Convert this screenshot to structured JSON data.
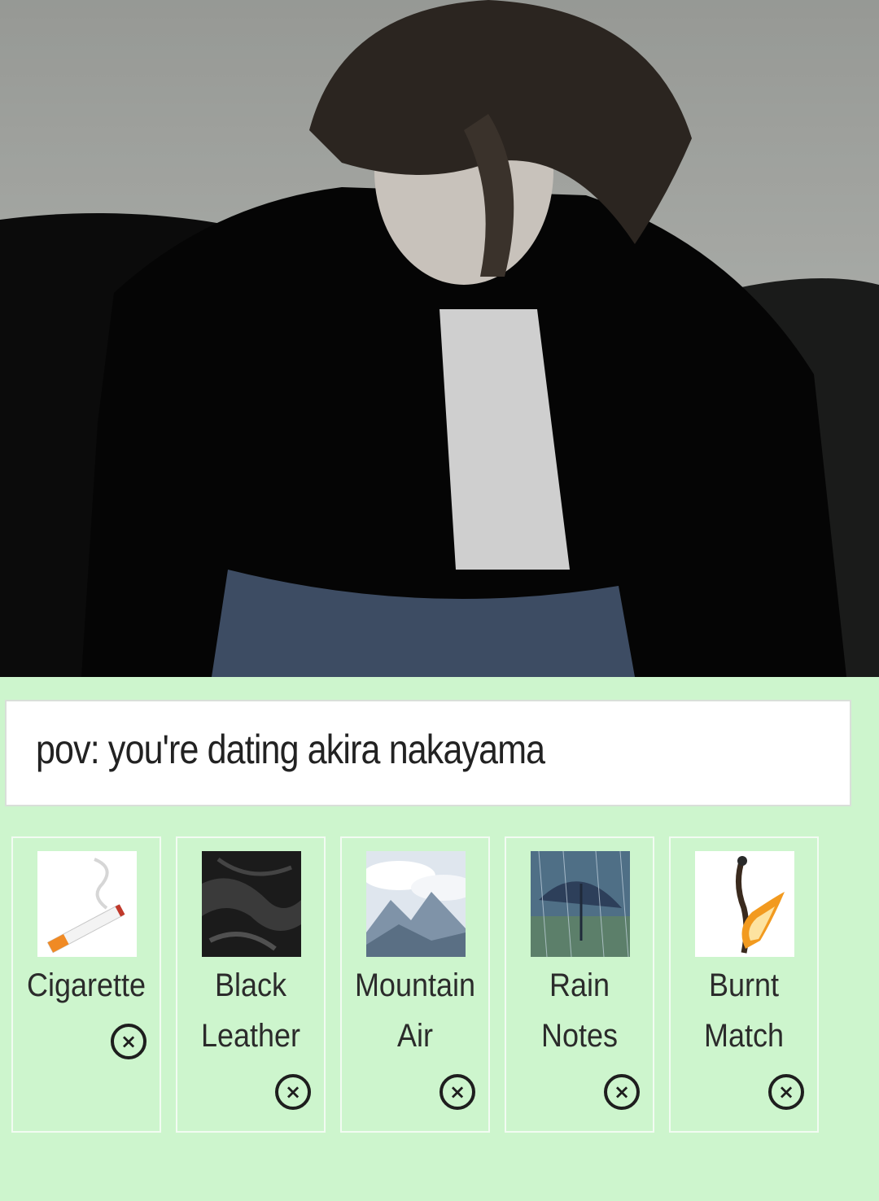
{
  "post": {
    "title": "pov: you're dating akira nakayama"
  },
  "tags": [
    {
      "label_line1": "Cigarette",
      "label_line2": "",
      "icon": "cigarette-icon"
    },
    {
      "label_line1": "Black",
      "label_line2": "Leather",
      "icon": "black-leather-image"
    },
    {
      "label_line1": "Mountain",
      "label_line2": "Air",
      "icon": "mountain-image"
    },
    {
      "label_line1": "Rain",
      "label_line2": "Notes",
      "icon": "umbrella-rain-image"
    },
    {
      "label_line1": "Burnt",
      "label_line2": "Match",
      "icon": "burnt-match-icon"
    }
  ],
  "remove_glyph": "×",
  "colors": {
    "background": "#cdf5cd",
    "card_border": "#f2fbf2",
    "text": "#222222"
  }
}
